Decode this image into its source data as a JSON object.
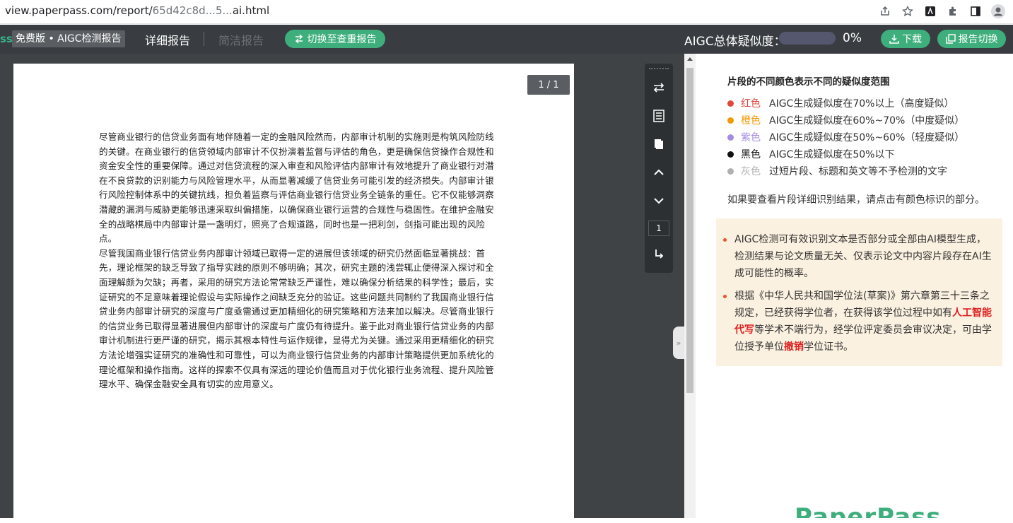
{
  "browser": {
    "url_prefix": "view.paperpass.com/report/",
    "url_masked": "65d42c8d...5...",
    "url_suffix": "ai.html"
  },
  "header": {
    "brand_tail": "ss",
    "edition": "免费版 • AIGC检测报告",
    "tab_detail": "详细报告",
    "tab_simple": "简洁报告",
    "switch_button": "切换至查重报告",
    "aigc_label": "AIGC总体疑似度：",
    "aigc_percent": "0%",
    "aigc_fraction": 0,
    "download_button": "下载",
    "report_switch_button": "报告切换"
  },
  "viewer": {
    "page_counter": "1 / 1",
    "page_input": "1",
    "paragraphs": [
      "尽管商业银行的信贷业务面有地伴随着一定的金融风险然而，内部审计机制的实施则是构筑风险防线的关键。在商业银行的信贷领域内部审计不仅扮演着监督与评估的角色，更是确保信贷操作合规性和资金安全性的重要保障。通过对信贷流程的深入审查和风险评估内部审计有效地提升了商业银行对潜在不良贷款的识别能力与风险管理水平，从而显著减缓了信贷业务可能引发的经济损失。内部审计银行风险控制体系中的关键抗线，担负着监察与评估商业银行信贷业务全链条的重任。它不仅能够洞察潜藏的漏洞与威胁更能够迅速采取纠偏措施，以确保商业银行运营的合规性与稳固性。在维护金融安全的战略棋局中内部审计是一盏明灯，照亮了合规道路，同时也是一把利剑，剑指可能出现的风险点。",
      "尽管我国商业银行信贷业务内部审计领域已取得一定的进展但该领域的研究仍然面临显著挑战：首先，理论框架的缺乏导致了指导实践的原则不够明确；其次，研究主题的浅尝辄止便得深入探讨和全面理解颇为欠缺；再者，采用的研究方法论常常缺乏严谨性，难以确保分析结果的科学性；最后，实证研究的不足意味着理论假设与实际操作之间缺乏充分的验证。这些问题共同制约了我国商业银行信贷业务内部审计研究的深度与广度亟需通过更加精细化的研究策略和方法来加以解决。尽管商业银行的信贷业务已取得显著进展但内部审计的深度与广度仍有待提升。鉴于此对商业银行信贷业务的内部审计机制进行更严谨的研究，揭示其根本特性与运作规律，显得尤为关键。通过采用更精细化的研究方法论增强实证研究的准确性和可靠性，可以为商业银行信贷业务的内部审计策略提供更加系统化的理论框架和操作指南。这样的探索不仅具有深远的理论价值而且对于优化银行业务流程、提升风险管理水平、确保金融安全具有切实的应用意义。"
    ]
  },
  "panel": {
    "legend_title": "片段的不同颜色表示不同的疑似度范围",
    "legend": [
      {
        "color_name": "红色",
        "desc": "AIGC生成疑似度在70%以上（高度疑似）",
        "hex": "#e5453b"
      },
      {
        "color_name": "橙色",
        "desc": "AIGC生成疑似度在60%~70%（中度疑似）",
        "hex": "#f39800"
      },
      {
        "color_name": "紫色",
        "desc": "AIGC生成疑似度在50%~60%（轻度疑似）",
        "hex": "#a48be0"
      },
      {
        "color_name": "黑色",
        "desc": "AIGC生成疑似度在50%以下",
        "hex": "#111111"
      },
      {
        "color_name": "灰色",
        "desc": "过短片段、标题和英文等不予检测的文字",
        "hex": "#b0b0b0"
      }
    ],
    "hint": "如果要查看片段详细识别结果，请点击有颜色标识的部分。",
    "notice1": "AIGC检测可有效识别文本是否部分或全部由AI模型生成，检测结果与论文质量无关、仅表示论文中内容片段存在AI生成可能性的概率。",
    "notice2_a": "根据《中华人民共和国学位法(草案)》第六章第三十三条之规定，已经获得学位者，在获得该学位过程中如有",
    "notice2_hl1": "人工智能代写",
    "notice2_b": "等学术不端行为，经学位评定委员会审议决定，可由学位授予单位",
    "notice2_hl2": "撤销",
    "notice2_c": "学位证书。",
    "logo": "PaperPass"
  },
  "colors": {
    "accent": "#3eaf7c",
    "header_bg": "#393d41",
    "viewer_bg": "#3f4346",
    "notice_bg": "#fbf1e0",
    "highlight_red": "#e02020"
  }
}
